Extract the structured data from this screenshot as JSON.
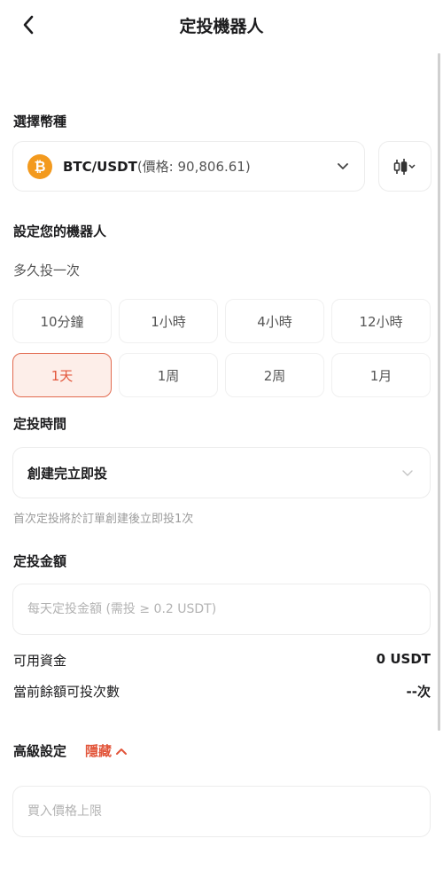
{
  "header": {
    "title": "定投機器人"
  },
  "coin": {
    "section_title": "選擇幣種",
    "icon_glyph": "₿",
    "pair": "BTC/USDT",
    "price_text": "(價格: 90,806.61)",
    "icon_color": "#f39a1e"
  },
  "setup": {
    "section_title": "設定您的機器人",
    "frequency_label": "多久投一次",
    "frequency_options": [
      {
        "label": "10分鐘",
        "selected": false
      },
      {
        "label": "1小時",
        "selected": false
      },
      {
        "label": "4小時",
        "selected": false
      },
      {
        "label": "12小時",
        "selected": false
      },
      {
        "label": "1天",
        "selected": true
      },
      {
        "label": "1周",
        "selected": false
      },
      {
        "label": "2周",
        "selected": false
      },
      {
        "label": "1月",
        "selected": false
      }
    ]
  },
  "timing": {
    "section_title": "定投時間",
    "value": "創建完立即投",
    "hint": "首次定投將於訂單創建後立即投1次"
  },
  "amount": {
    "section_title": "定投金額",
    "placeholder": "每天定投金額 (需投 ≥ 0.2 USDT)"
  },
  "funds": {
    "available_label": "可用資金",
    "available_value": "0 USDT",
    "times_label": "當前餘額可投次數",
    "times_value": "--次"
  },
  "advanced": {
    "title": "高級設定",
    "toggle_label": "隱藏",
    "price_limit_placeholder": "買入價格上限"
  },
  "colors": {
    "accent": "#e2553a",
    "selected_bg": "#fdeee9"
  }
}
